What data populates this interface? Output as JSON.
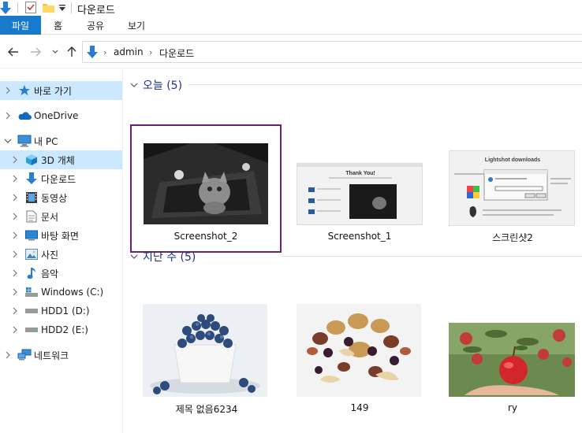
{
  "window": {
    "title": "다운로드"
  },
  "ribbon": {
    "file_tab": "파일",
    "tabs": [
      "홈",
      "공유",
      "보기"
    ]
  },
  "address": {
    "crumbs": [
      "admin",
      "다운로드"
    ]
  },
  "sidebar": {
    "items": [
      {
        "label": "바로 가기",
        "icon": "star-pin-icon"
      },
      {
        "label": "OneDrive",
        "icon": "cloud-icon"
      },
      {
        "label": "내 PC",
        "icon": "computer-icon"
      },
      {
        "label": "3D 개체",
        "icon": "cube-3d-icon"
      },
      {
        "label": "다운로드",
        "icon": "download-arrow-icon"
      },
      {
        "label": "동영상",
        "icon": "film-icon"
      },
      {
        "label": "문서",
        "icon": "document-icon"
      },
      {
        "label": "바탕 화면",
        "icon": "desktop-icon"
      },
      {
        "label": "사진",
        "icon": "picture-icon"
      },
      {
        "label": "음악",
        "icon": "music-note-icon"
      },
      {
        "label": "Windows (C:)",
        "icon": "windows-drive-icon"
      },
      {
        "label": "HDD1 (D:)",
        "icon": "drive-icon"
      },
      {
        "label": "HDD2 (E:)",
        "icon": "drive-icon"
      },
      {
        "label": "네트워크",
        "icon": "network-icon"
      }
    ]
  },
  "groups": [
    {
      "label": "오늘 (5)",
      "files": [
        {
          "name": "Screenshot_2",
          "selected": true
        },
        {
          "name": "Screenshot_1"
        },
        {
          "name": "스크린샷2"
        }
      ]
    },
    {
      "label": "지난 주 (5)",
      "files": [
        {
          "name": "제목 없음6234"
        },
        {
          "name": "149"
        },
        {
          "name": "ry"
        }
      ]
    }
  ],
  "thumb_text": {
    "thank_you": "Thank You!",
    "lightshot": "Lightshot downloads"
  },
  "colors": {
    "accent": "#1979ca",
    "selection": "#cce8ff",
    "tile_border": "#6e1f6e",
    "group_text": "#1e3287"
  }
}
